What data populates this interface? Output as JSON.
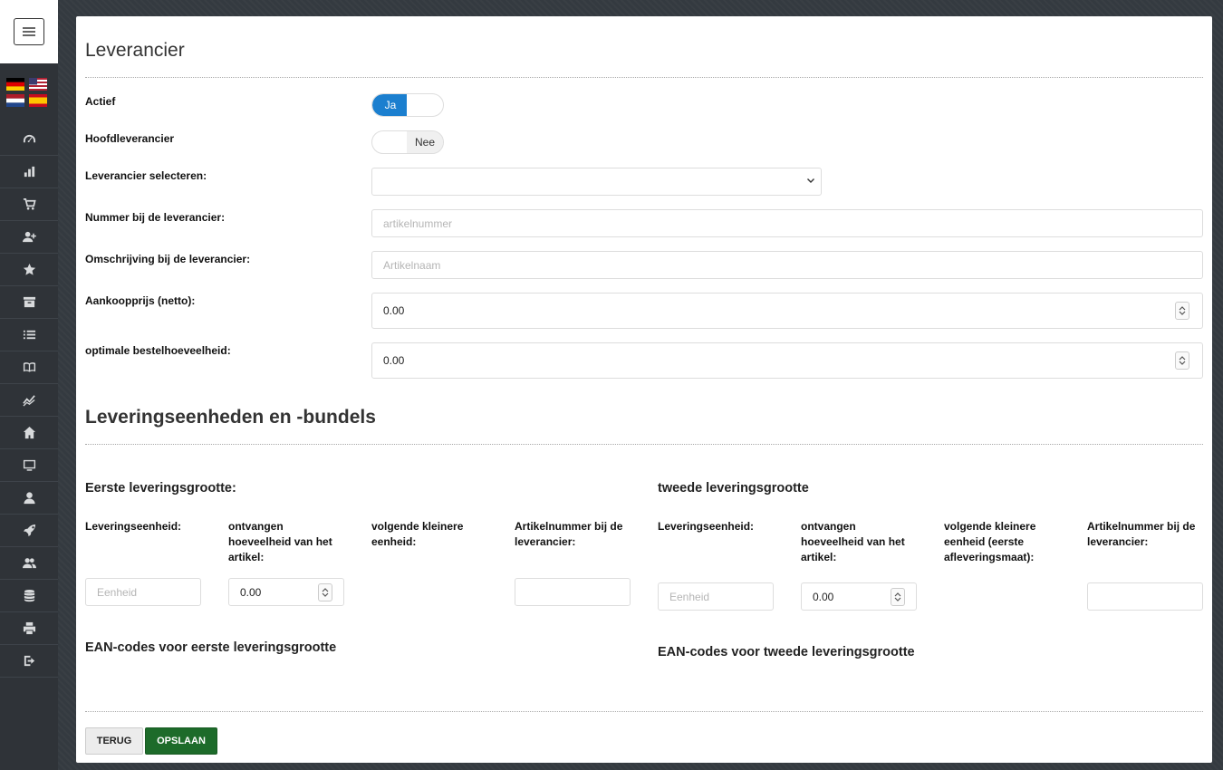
{
  "sidebar": {
    "icons": [
      "dashboard-icon",
      "bar-chart-icon",
      "cart-icon",
      "add-user-icon",
      "star-icon",
      "archive-icon",
      "list-icon",
      "book-icon",
      "trend-icon",
      "home-icon",
      "monitor-icon",
      "user-icon",
      "rocket-icon",
      "users-icon",
      "database-icon",
      "print-icon",
      "logout-icon"
    ]
  },
  "form": {
    "title": "Leverancier",
    "actief_label": "Actief",
    "actief_value": "Ja",
    "hoofd_label": "Hoofdleverancier",
    "hoofd_value": "Nee",
    "select_label": "Leverancier selecteren:",
    "select_value": "",
    "nummer_label": "Nummer bij de leverancier:",
    "nummer_placeholder": "artikelnummer",
    "omschrijving_label": "Omschrijving bij de leverancier:",
    "omschrijving_placeholder": "Artikelnaam",
    "aankoop_label": "Aankoopprijs (netto):",
    "aankoop_value": "0.00",
    "optimale_label": "optimale bestelhoeveelheid:",
    "optimale_value": "0.00"
  },
  "delivery": {
    "title": "Leveringseenheden en -bundels",
    "first": {
      "title": "Eerste leveringsgrootte:",
      "col1": "Leveringseenheid:",
      "col2": "ontvangen hoeveelheid van het artikel:",
      "col3": "volgende kleinere eenheid:",
      "col4": "Artikelnummer bij de leverancier:",
      "unit_placeholder": "Eenheid",
      "qty_value": "0.00",
      "ean_title": "EAN-codes voor eerste leveringsgrootte"
    },
    "second": {
      "title": "tweede leveringsgrootte",
      "col1": "Leveringseenheid:",
      "col2": "ontvangen hoeveelheid van het artikel:",
      "col3": "volgende kleinere eenheid (eerste afleveringsmaat):",
      "col4": "Artikelnummer bij de leverancier:",
      "unit_placeholder": "Eenheid",
      "qty_value": "0.00",
      "ean_title": "EAN-codes voor tweede leveringsgrootte"
    }
  },
  "buttons": {
    "back": "TERUG",
    "save": "OPSLAAN"
  }
}
